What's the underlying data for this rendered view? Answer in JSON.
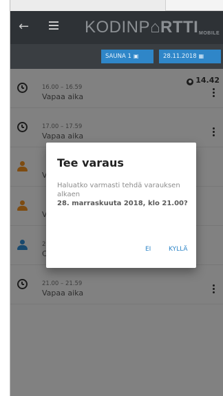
{
  "header": {
    "logo_main": "KODINP",
    "logo_second": "RTTI",
    "logo_sub": "MOBILE"
  },
  "filters": {
    "sauna_label": "SAUNA 1",
    "date_label": "28.11.2018"
  },
  "temperature": "14.42",
  "rows": [
    {
      "time": "16.00 – 16.59",
      "status": "Vapaa aika"
    },
    {
      "time": "17.00 – 17.59",
      "status": "Vapaa aika"
    },
    {
      "time": "",
      "status": "V"
    },
    {
      "time": "",
      "status": "V"
    },
    {
      "time": "2",
      "status": "C"
    },
    {
      "time": "21.00 – 21.59",
      "status": "Vapaa aika"
    }
  ],
  "dialog": {
    "title": "Tee varaus",
    "message": "Haluatko varmasti tehdä varauksen alkaen",
    "datetime": "28. marraskuuta 2018, klo 21.00?",
    "cancel": "EI",
    "confirm": "KYLLÄ"
  },
  "colors": {
    "accent": "#2f86c8",
    "topbar": "#2e3236",
    "user_orange": "#e68a1f"
  }
}
